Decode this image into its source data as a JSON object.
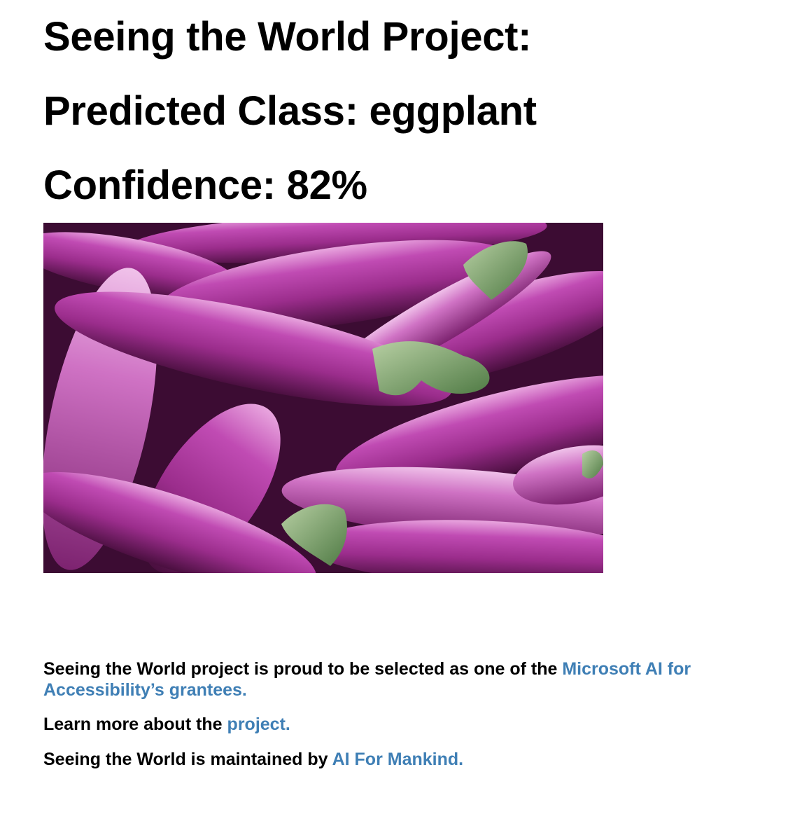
{
  "page": {
    "title": "Seeing the World Project:",
    "predicted_label": "Predicted Class: ",
    "predicted_class": "eggplant",
    "confidence_label": "Confidence: ",
    "confidence_value": "82%"
  },
  "image": {
    "subject": "eggplant-photo",
    "colors": {
      "skin": "#9b2d8c",
      "highlight": "#e9a6df",
      "shadow": "#4a0f3f",
      "stem": "#7aa36a"
    }
  },
  "footer": {
    "grantee_text": "Seeing the World project is proud to be selected as one of the ",
    "grantee_link": "Microsoft AI for Accessibility’s grantees.",
    "learn_text": "Learn more about the ",
    "learn_link": "project.",
    "maintained_text": "Seeing the World is maintained by ",
    "maintained_link": "AI For Mankind."
  },
  "colors": {
    "link": "#3f7fb5",
    "text": "#000000"
  }
}
